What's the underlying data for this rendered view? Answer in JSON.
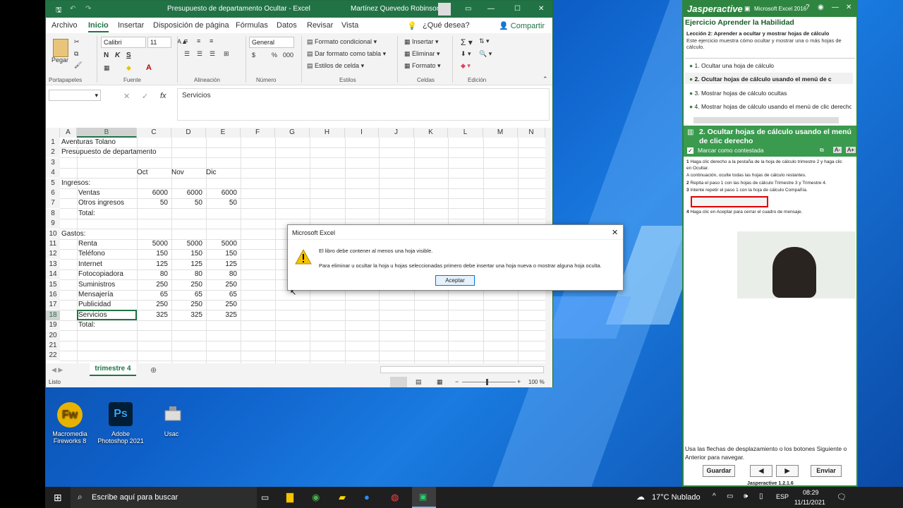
{
  "excel": {
    "title": "Presupuesto de departamento Ocultar  -  Excel",
    "user": "Martínez Quevedo  Robinson",
    "tabs": [
      "Archivo",
      "Inicio",
      "Insertar",
      "Disposición de página",
      "Fórmulas",
      "Datos",
      "Revisar",
      "Vista"
    ],
    "search": "¿Qué desea?",
    "share": "Compartir",
    "ribbon": {
      "paste": "Pegar",
      "clipboard": "Portapapeles",
      "font_name": "Calibri",
      "font_size": "11",
      "bold": "N",
      "italic": "K",
      "underline": "S",
      "font_group": "Fuente",
      "align_group": "Alineación",
      "num_format": "General",
      "num_group": "Número",
      "cond_format": "Formato condicional",
      "table_format": "Dar formato como tabla",
      "cell_styles": "Estilos de celda",
      "styles_group": "Estilos",
      "insert": "Insertar",
      "delete": "Eliminar",
      "format": "Formato",
      "cells_group": "Celdas",
      "edit_group": "Edición"
    },
    "formula_value": "Servicios",
    "columns": [
      "A",
      "B",
      "C",
      "D",
      "E",
      "F",
      "G",
      "H",
      "I",
      "J",
      "K",
      "L",
      "M",
      "N"
    ],
    "rows": [
      {
        "n": "1",
        "a": "Aventuras Tolano",
        "b": "",
        "c": "",
        "d": "",
        "e": ""
      },
      {
        "n": "2",
        "a": "Presupuesto de departamento",
        "b": "",
        "c": "",
        "d": "",
        "e": ""
      },
      {
        "n": "3",
        "a": "",
        "b": "",
        "c": "",
        "d": "",
        "e": ""
      },
      {
        "n": "4",
        "a": "",
        "b": "",
        "c": "Oct",
        "d": "Nov",
        "e": "Dic"
      },
      {
        "n": "5",
        "a": "Ingresos:",
        "b": "",
        "c": "",
        "d": "",
        "e": ""
      },
      {
        "n": "6",
        "a": "",
        "b": "Ventas",
        "c": "6000",
        "d": "6000",
        "e": "6000"
      },
      {
        "n": "7",
        "a": "",
        "b": "Otros ingresos",
        "c": "50",
        "d": "50",
        "e": "50"
      },
      {
        "n": "8",
        "a": "",
        "b": "Total:",
        "c": "",
        "d": "",
        "e": ""
      },
      {
        "n": "9",
        "a": "",
        "b": "",
        "c": "",
        "d": "",
        "e": ""
      },
      {
        "n": "10",
        "a": "Gastos:",
        "b": "",
        "c": "",
        "d": "",
        "e": ""
      },
      {
        "n": "11",
        "a": "",
        "b": "Renta",
        "c": "5000",
        "d": "5000",
        "e": "5000"
      },
      {
        "n": "12",
        "a": "",
        "b": "Teléfono",
        "c": "150",
        "d": "150",
        "e": "150"
      },
      {
        "n": "13",
        "a": "",
        "b": "Internet",
        "c": "125",
        "d": "125",
        "e": "125"
      },
      {
        "n": "14",
        "a": "",
        "b": "Fotocopiadora",
        "c": "80",
        "d": "80",
        "e": "80"
      },
      {
        "n": "15",
        "a": "",
        "b": "Suministros",
        "c": "250",
        "d": "250",
        "e": "250"
      },
      {
        "n": "16",
        "a": "",
        "b": "Mensajería",
        "c": "65",
        "d": "65",
        "e": "65"
      },
      {
        "n": "17",
        "a": "",
        "b": "Publicidad",
        "c": "250",
        "d": "250",
        "e": "250"
      },
      {
        "n": "18",
        "a": "",
        "b": "Servicios",
        "c": "325",
        "d": "325",
        "e": "325"
      },
      {
        "n": "19",
        "a": "",
        "b": "Total:",
        "c": "",
        "d": "",
        "e": ""
      },
      {
        "n": "20",
        "a": "",
        "b": "",
        "c": "",
        "d": "",
        "e": ""
      },
      {
        "n": "21",
        "a": "",
        "b": "",
        "c": "",
        "d": "",
        "e": ""
      },
      {
        "n": "22",
        "a": "",
        "b": "",
        "c": "",
        "d": "",
        "e": ""
      }
    ],
    "sheet_tab": "trimestre 4",
    "status": "Listo",
    "zoom": "100 %"
  },
  "dialog": {
    "title": "Microsoft Excel",
    "line1": "El libro debe contener al menos una hoja visible.",
    "line2": "Para eliminar u ocultar la hoja u hojas seleccionadas primero debe insertar una hoja nueva o mostrar alguna hoja oculta.",
    "ok": "Aceptar"
  },
  "jasper": {
    "brand": "Jasperactive",
    "product": "Microsoft Excel 2016",
    "heading": "Ejercicio Aprender la Habilidad",
    "lesson": "Lección 2: Aprender a ocultar y mostrar hojas de cálculo",
    "lesson_desc": "Este ejercicio muestra cómo ocultar y mostrar una o más hojas de cálculo.",
    "tasks": [
      "1. Ocultar una hoja de cálculo",
      "2. Ocultar hojas de cálculo usando el menú de c",
      "3. Mostrar hojas de cálculo ocultas",
      "4. Mostrar hojas de cálculo usando el menú de clic derecho"
    ],
    "section_title": "2. Ocultar hojas de cálculo usando el menú de clic derecho",
    "mark": "Marcar como contestada",
    "font_minus": "A-",
    "font_plus": "A+",
    "steps": {
      "s1": "Haga clic derecho a la pestaña de la hoja de cálculo trimestre 2 y haga clic en Ocultar.",
      "s1b": "A continuación, oculte todas las hojas de cálculo restantes.",
      "s2": "Repita el paso 1 con las hojas de cálculo Trimestre 3 y Trimestre 4.",
      "s3": "Intente repetir el paso 1 con la hoja de cálculo Compañía.",
      "s4": "Haga clic en Aceptar para cerrar el cuadro de mensaje."
    },
    "nav_hint": "Usa las flechas de desplazamiento o los botones Siguiente o Anterior para navegar.",
    "save": "Guardar",
    "send": "Enviar",
    "version": "Jasperactive 1.2.1.6"
  },
  "desktop": {
    "icons": [
      {
        "label": "Macromedia Fireworks 8"
      },
      {
        "label": "Adobe Photoshop 2021",
        "glyph": "Ps"
      },
      {
        "label": "Usac"
      }
    ]
  },
  "taskbar": {
    "search": "Escribe aquí para buscar",
    "weather": "17°C  Nublado",
    "lang": "ESP",
    "time": "08:29",
    "date": "11/11/2021"
  },
  "colors": {
    "excel_green": "#217346",
    "jasper_green": "#2e8540",
    "taskbar": "#1f1f1f"
  }
}
